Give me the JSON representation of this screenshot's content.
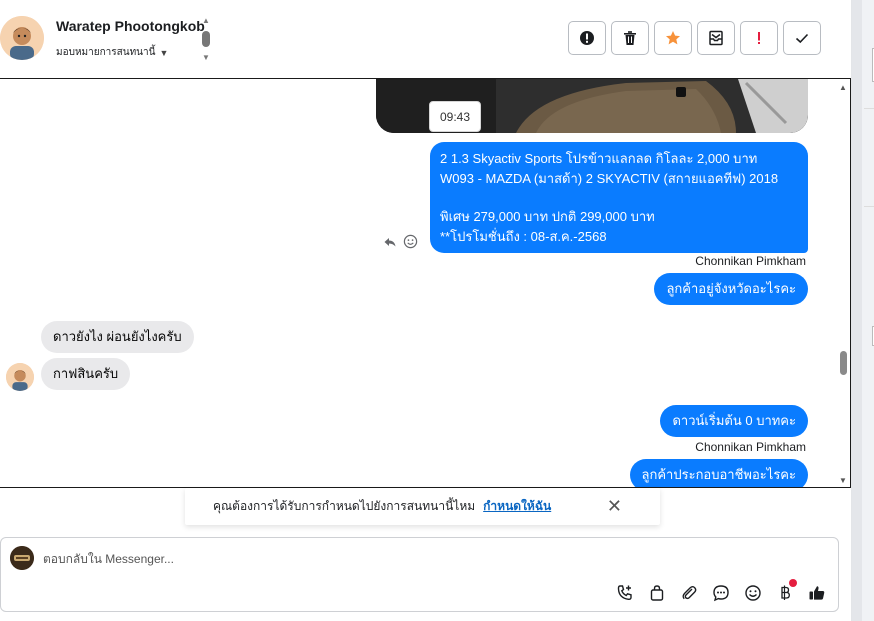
{
  "header": {
    "contact_name": "Waratep Phootongkob",
    "assign_label": "มอบหมายการสนทนานี้",
    "tools": [
      {
        "name": "spam-report",
        "icon": "exclamation-circle-icon"
      },
      {
        "name": "delete",
        "icon": "trash-icon"
      },
      {
        "name": "star",
        "icon": "star-icon",
        "color": "#f7923b"
      },
      {
        "name": "archive",
        "icon": "archive-icon"
      },
      {
        "name": "mark-important",
        "icon": "exclamation-icon",
        "color": "#e41e3f"
      },
      {
        "name": "mark-done",
        "icon": "check-icon"
      }
    ]
  },
  "chat": {
    "photo_time": "09:43",
    "product_message": {
      "line1": "2 1.3 Skyactiv Sports โปรข้าวแลกลด กิโลละ 2,000 บาท",
      "line2": "W093 - MAZDA (มาสด้า) 2 SKYACTIV (สกายแอคทีฟ) 2018",
      "line3": "พิเศษ 279,000 บาท  ปกติ 299,000 บาท",
      "line4": "**โปรโมชั่นถึง : 08-ส.ค.-2568"
    },
    "sender1": "Chonnikan Pimkham",
    "out_msg1": "ลูกค้าอยู่จังหวัดอะไรคะ",
    "in_msg1": "ดาวยังไง ผ่อนยังไงครับ",
    "in_msg2": "กาฟสินครับ",
    "out_msg2": "ดาวน์เริ่มต้น 0 บาทคะ",
    "sender2": "Chonnikan Pimkham",
    "out_msg3": "ลูกค้าประกอบอาชีพอะไรคะ"
  },
  "notice": {
    "text": "คุณต้องการได้รับการกำหนดไปยังการสนทนานี้ไหม",
    "link": "กำหนดให้ฉัน",
    "close": "✕"
  },
  "composer": {
    "placeholder": "ตอบกลับใน Messenger...",
    "icons": [
      "phone-plus-icon",
      "shopping-bag-icon",
      "paperclip-icon",
      "chat-bubble-icon",
      "emoji-icon",
      "baht-icon",
      "thumbs-up-icon"
    ]
  },
  "colors": {
    "accent_blue": "#0a7cff",
    "incoming_gray": "#e9e9eb",
    "link_blue": "#0a66c2"
  }
}
